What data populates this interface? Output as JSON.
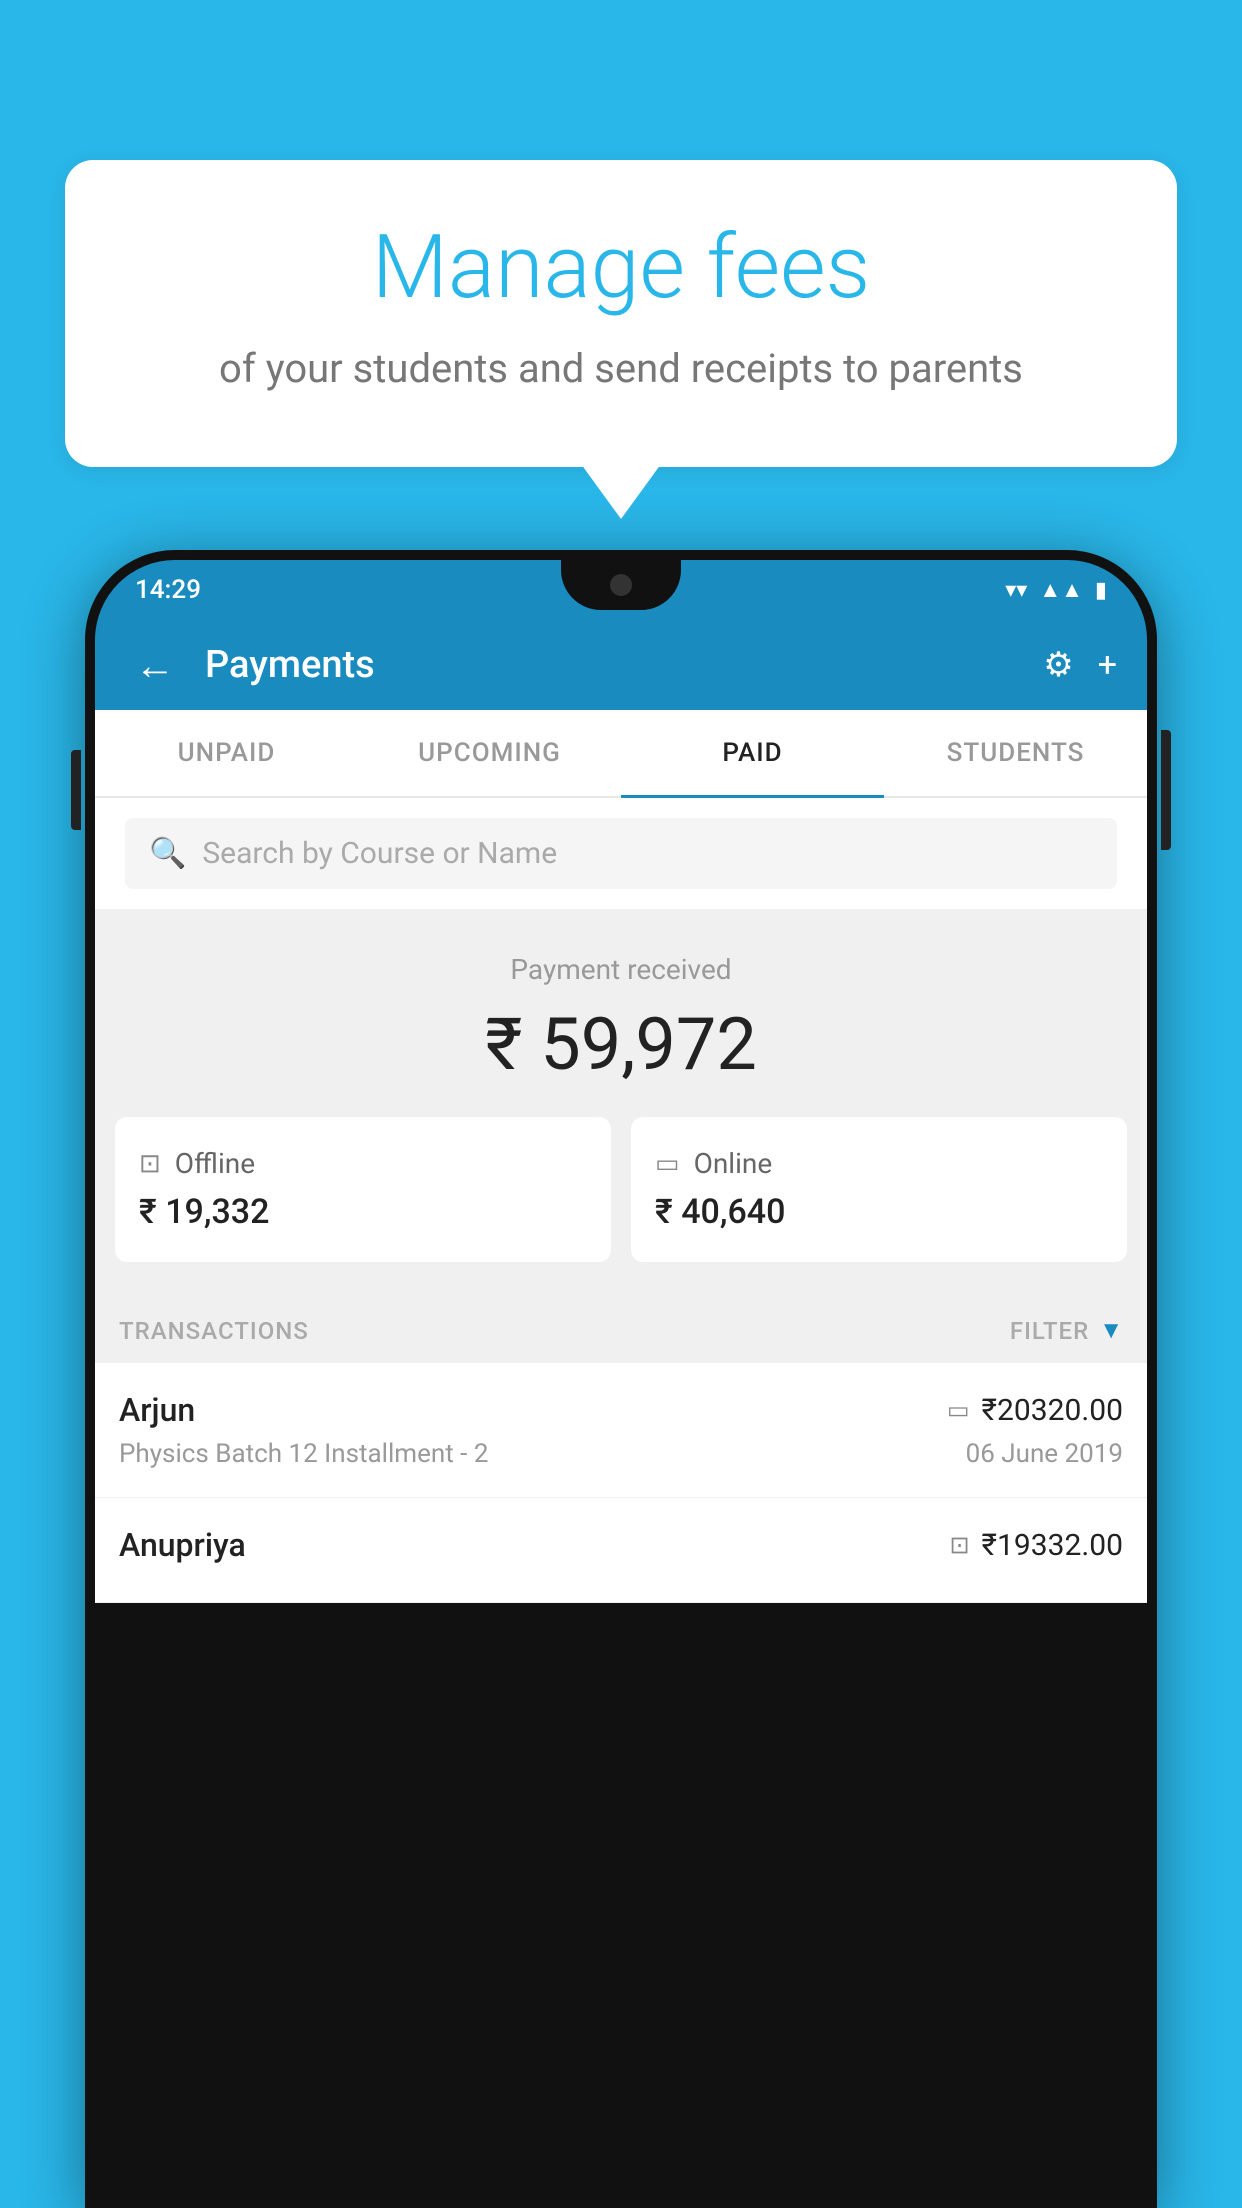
{
  "background_color": "#29b6e8",
  "bubble": {
    "title": "Manage fees",
    "subtitle": "of your students and send receipts to parents"
  },
  "status_bar": {
    "time": "14:29",
    "wifi_icon": "▼",
    "signal_icon": "▲",
    "battery_icon": "▮"
  },
  "app_bar": {
    "back_icon": "←",
    "title": "Payments",
    "gear_icon": "⚙",
    "plus_icon": "+"
  },
  "tabs": [
    {
      "label": "UNPAID",
      "active": false
    },
    {
      "label": "UPCOMING",
      "active": false
    },
    {
      "label": "PAID",
      "active": true
    },
    {
      "label": "STUDENTS",
      "active": false
    }
  ],
  "search": {
    "placeholder": "Search by Course or Name",
    "search_icon": "🔍"
  },
  "payment_section": {
    "label": "Payment received",
    "amount": "₹ 59,972",
    "offline": {
      "icon": "💳",
      "label": "Offline",
      "amount": "₹ 19,332"
    },
    "online": {
      "icon": "💳",
      "label": "Online",
      "amount": "₹ 40,640"
    }
  },
  "transactions": {
    "header_label": "TRANSACTIONS",
    "filter_label": "FILTER",
    "filter_icon": "▼",
    "items": [
      {
        "name": "Arjun",
        "type_icon": "▭",
        "amount": "₹20320.00",
        "course": "Physics Batch 12 Installment - 2",
        "date": "06 June 2019"
      },
      {
        "name": "Anupriya",
        "type_icon": "▭",
        "amount": "₹19332.00",
        "course": "",
        "date": ""
      }
    ]
  }
}
